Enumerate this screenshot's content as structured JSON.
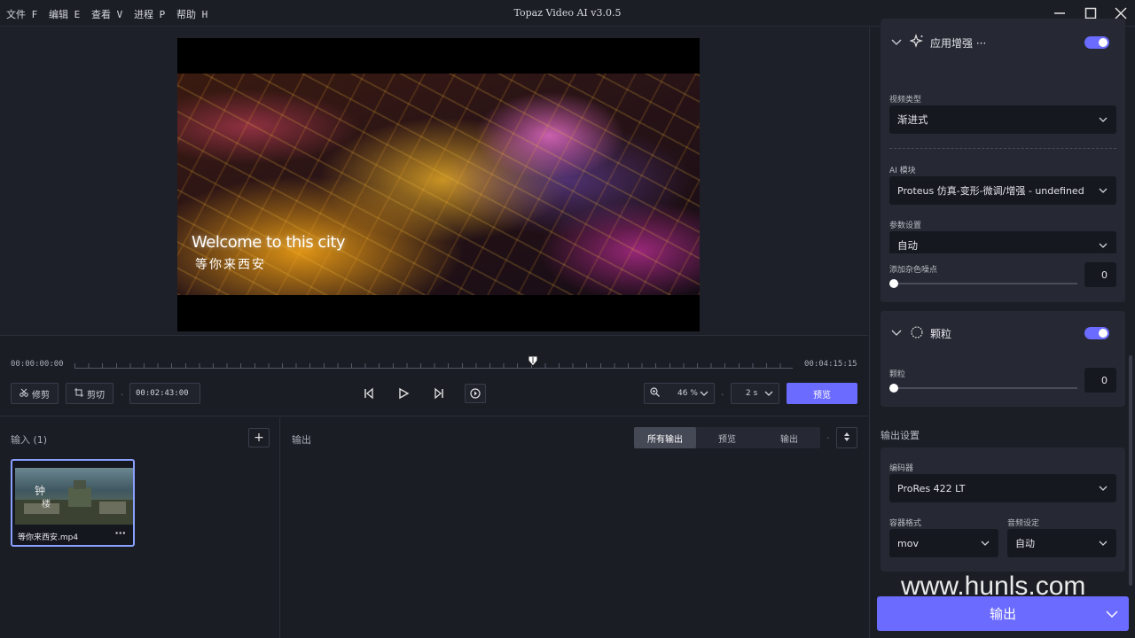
{
  "menu": {
    "file": "文件 F",
    "edit": "编辑 E",
    "view": "查看 V",
    "process": "进程 P",
    "help": "帮助 H"
  },
  "app_title": "Topaz Video AI  v3.0.5",
  "video": {
    "caption_en": "Welcome to this city",
    "caption_cn": "等你来西安"
  },
  "timeline": {
    "start_time": "00:00:00:00",
    "end_time": "00:04:15:15",
    "trim_label": "修剪",
    "crop_label": "剪切",
    "current_time": "00:02:43:00",
    "zoom_value": "46 %",
    "interval_value": "2 s",
    "preview_label": "预览"
  },
  "input_panel": {
    "title": "输入 (1)",
    "add_label": "+",
    "file_name": "等你来西安.mp4",
    "more_label": "···"
  },
  "output_panel": {
    "title": "输出",
    "tabs": [
      "所有输出",
      "预览",
      "输出"
    ],
    "active_tab": "所有输出"
  },
  "sidebar": {
    "enhance_section_title": "应用增强 ···",
    "enhance_enabled": true,
    "video_type_label": "视频类型",
    "video_type_value": "渐进式",
    "ai_model_label": "AI 模块",
    "ai_model_value": "Proteus 仿真-变形-微调/增强  - undefined",
    "params_label": "参数设置",
    "params_value": "自动",
    "noise_label": "添加杂色噪点",
    "noise_value": "0",
    "grain_section_title": "颗粒",
    "grain_enabled": true,
    "grain_label": "颗粒",
    "grain_value": "0",
    "output_settings_title": "输出设置",
    "encoder_label": "编码器",
    "encoder_value": "ProRes 422 LT",
    "container_label": "容器格式",
    "container_value": "mov",
    "audio_label": "音频设定",
    "audio_value": "自动",
    "export_label": "输出"
  },
  "watermark": "www.hunls.com",
  "colors": {
    "accent": "#6b6bff",
    "background": "#1c1e26",
    "panel": "#262933"
  }
}
